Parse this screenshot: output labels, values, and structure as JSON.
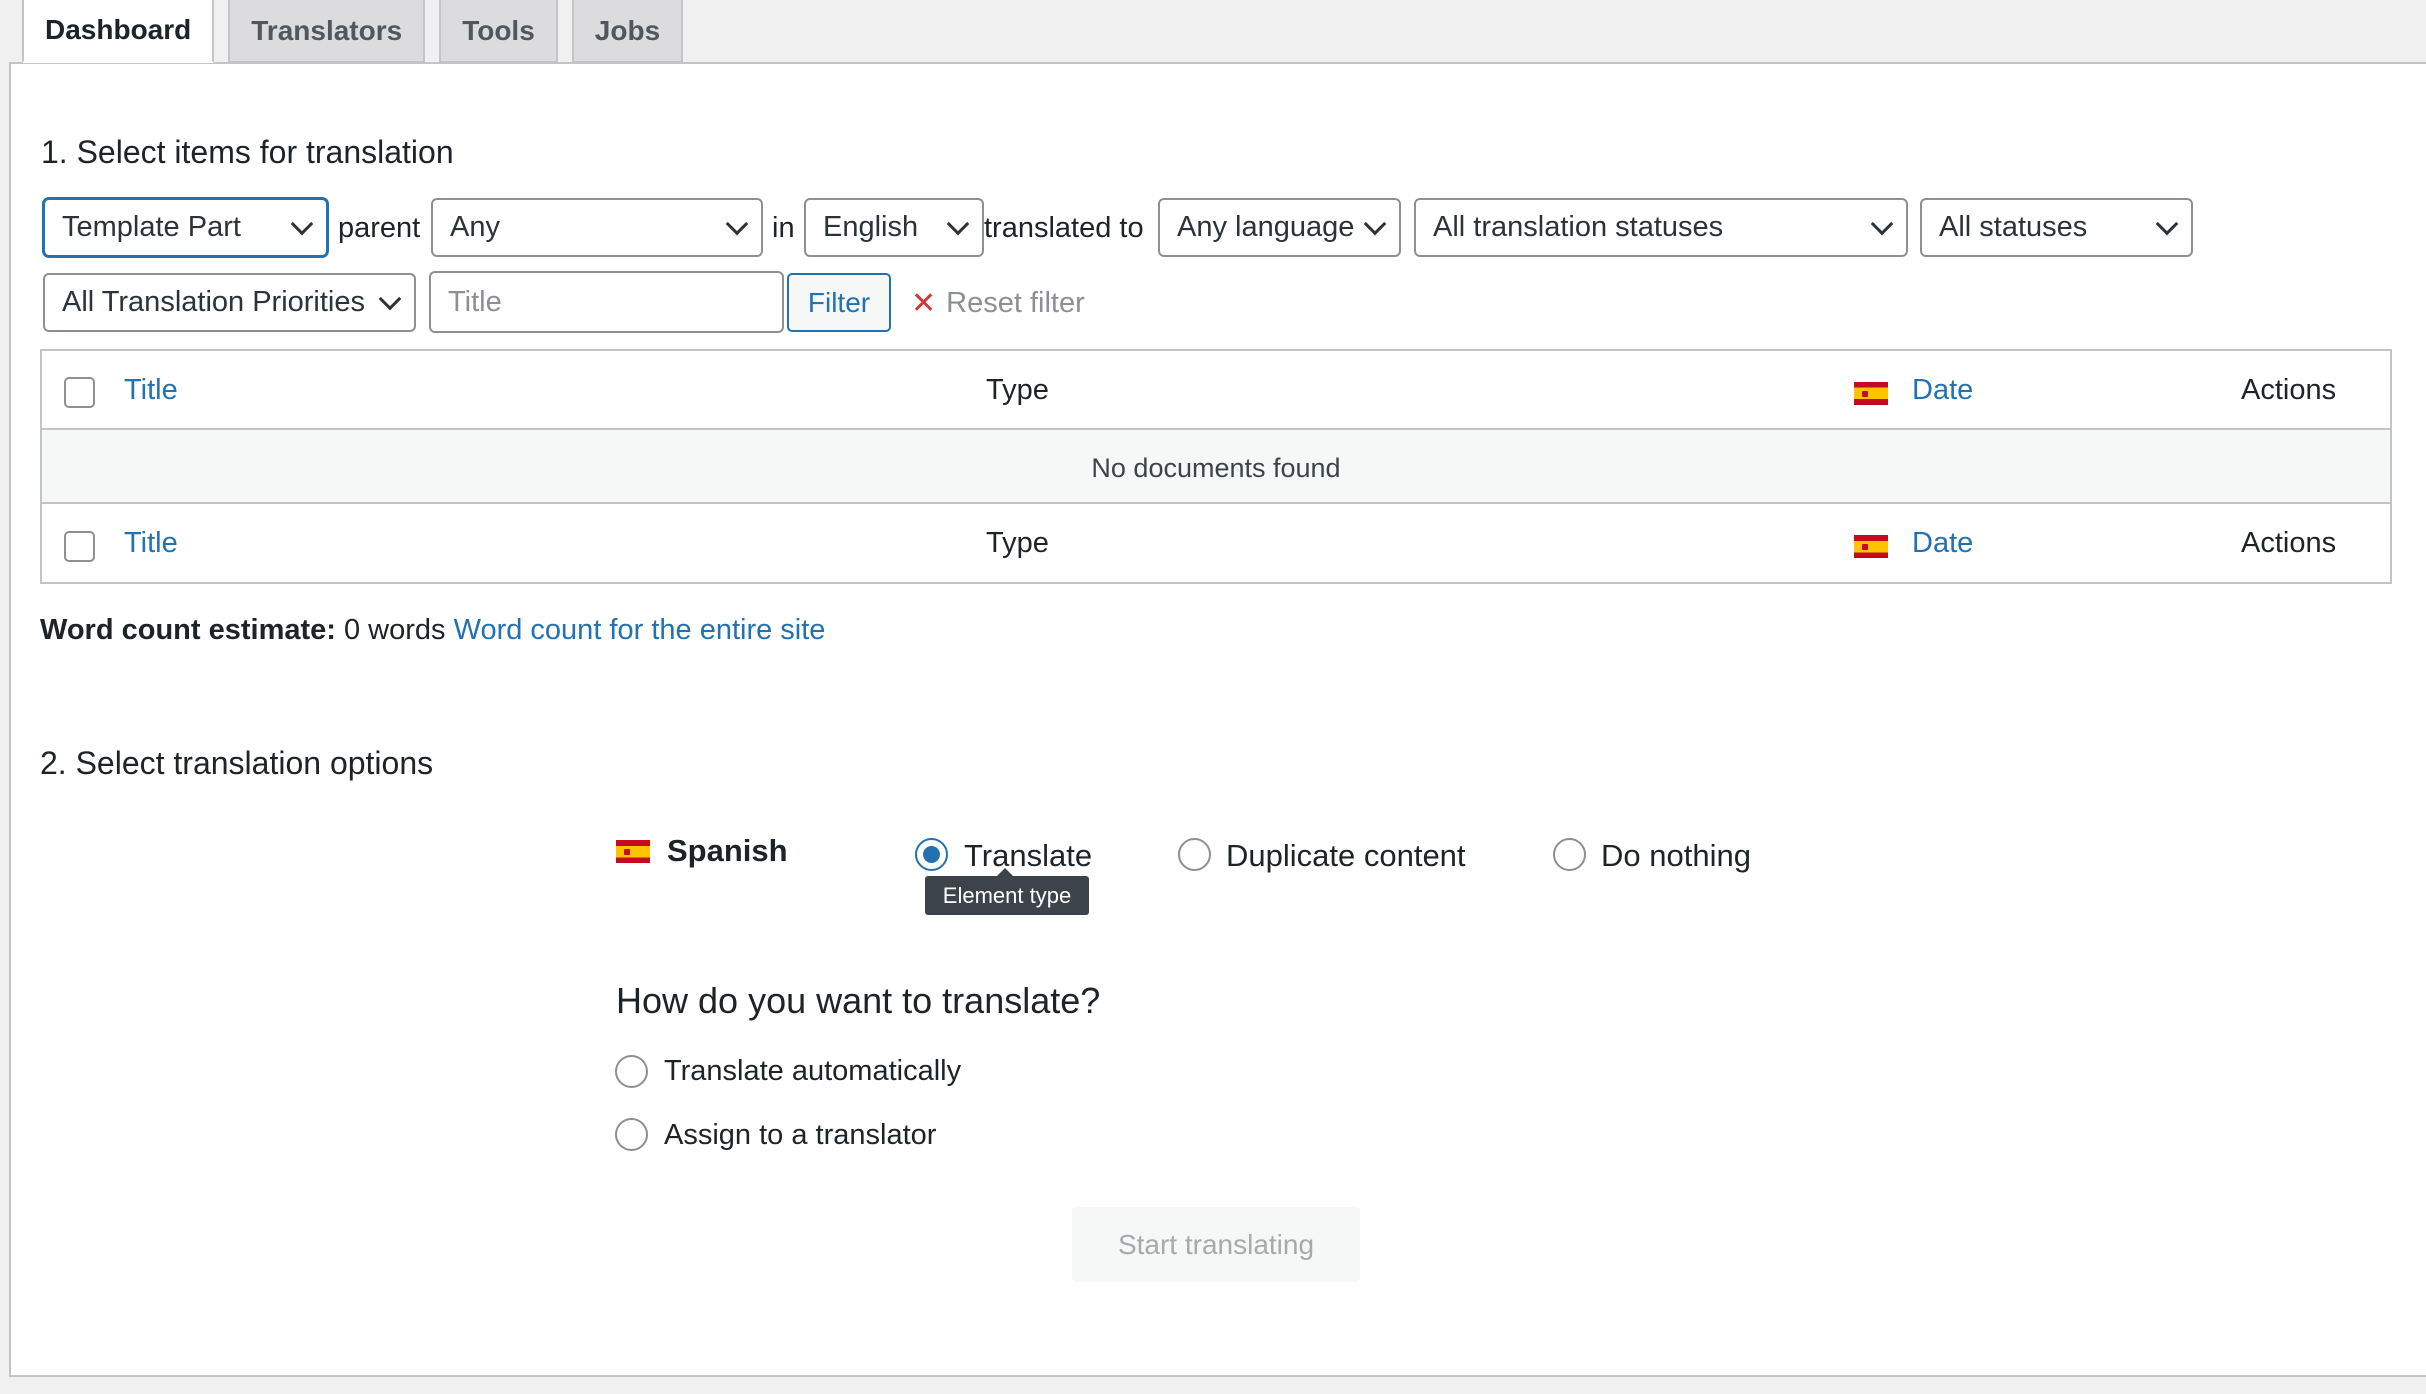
{
  "tabs": [
    {
      "label": "Dashboard",
      "active": true
    },
    {
      "label": "Translators",
      "active": false
    },
    {
      "label": "Tools",
      "active": false
    },
    {
      "label": "Jobs",
      "active": false
    }
  ],
  "section1": {
    "heading": "1. Select items for translation",
    "type_select": "Template Part",
    "parent_label": "parent",
    "parent_select": "Any",
    "in_label": "in",
    "language_select": "English",
    "translated_to_label": "translated to",
    "target_language_select": "Any language",
    "translation_status_select": "All translation statuses",
    "status_select": "All statuses",
    "priority_select": "All Translation Priorities",
    "title_placeholder": "Title",
    "filter_button": "Filter",
    "reset_filter": "Reset filter"
  },
  "table": {
    "columns": {
      "title": "Title",
      "type": "Type",
      "date": "Date",
      "actions": "Actions"
    },
    "empty_message": "No documents found"
  },
  "word_count": {
    "label": "Word count estimate:",
    "value": "0 words",
    "link": "Word count for the entire site"
  },
  "section2": {
    "heading": "2. Select translation options",
    "language": "Spanish",
    "options": [
      "Translate",
      "Duplicate content",
      "Do nothing"
    ],
    "selected_option": "Translate",
    "tooltip": "Element type",
    "how_heading": "How do you want to translate?",
    "methods": [
      "Translate automatically",
      "Assign to a translator"
    ],
    "start_button": "Start translating"
  },
  "colors": {
    "accent": "#2271b1",
    "flag_red": "#c60b1e",
    "flag_yellow": "#ffc400"
  },
  "icons": [
    "chevron-down-icon",
    "close-icon",
    "spain-flag-icon"
  ]
}
